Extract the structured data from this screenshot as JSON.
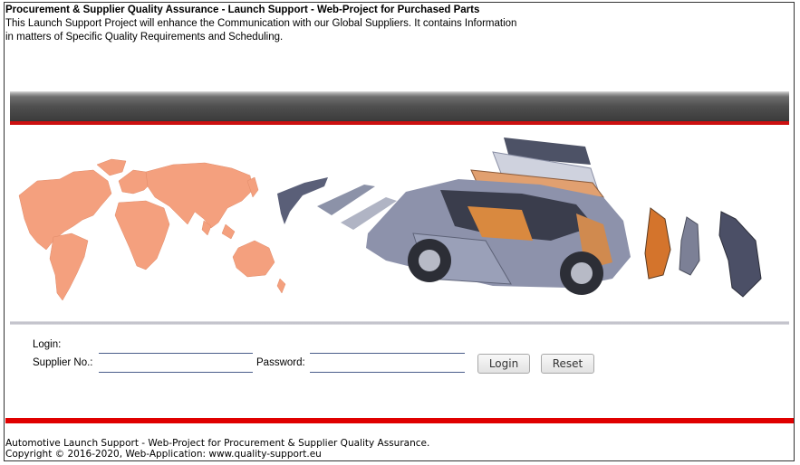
{
  "header": {
    "title": "Procurement & Supplier Quality Assurance - Launch Support - Web-Project for Purchased Parts",
    "description_line1": "This Launch Support Project will enhance the Communication with our Global Suppliers. It contains Information",
    "description_line2": "in matters of Specific Quality Requirements and Scheduling."
  },
  "banner": {
    "image": "world-map-and-exploded-car-illustration",
    "map_color": "#f4a07e",
    "accent_red": "#cc1010"
  },
  "login_form": {
    "login_label": "Login:",
    "supplier_no_label": "Supplier No.:",
    "supplier_no_value": "",
    "password_label": "Password:",
    "password_value": "",
    "login_button": "Login",
    "reset_button": "Reset"
  },
  "footer": {
    "line1": "Automotive Launch Support - Web-Project for Procurement & Supplier Quality Assurance.",
    "line2": "Copyright © 2016-2020, Web-Application: www.quality-support.eu"
  }
}
